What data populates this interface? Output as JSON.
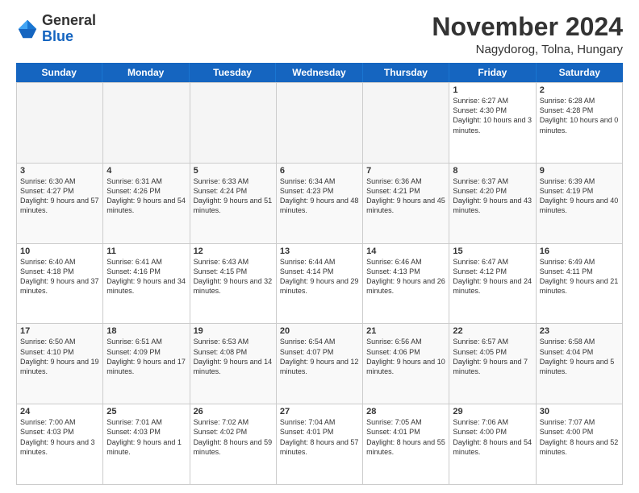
{
  "logo": {
    "line1": "General",
    "line2": "Blue"
  },
  "title": "November 2024",
  "location": "Nagydorog, Tolna, Hungary",
  "days_of_week": [
    "Sunday",
    "Monday",
    "Tuesday",
    "Wednesday",
    "Thursday",
    "Friday",
    "Saturday"
  ],
  "weeks": [
    [
      {
        "day": "",
        "info": "",
        "empty": true
      },
      {
        "day": "",
        "info": "",
        "empty": true
      },
      {
        "day": "",
        "info": "",
        "empty": true
      },
      {
        "day": "",
        "info": "",
        "empty": true
      },
      {
        "day": "",
        "info": "",
        "empty": true
      },
      {
        "day": "1",
        "info": "Sunrise: 6:27 AM\nSunset: 4:30 PM\nDaylight: 10 hours\nand 3 minutes.",
        "empty": false
      },
      {
        "day": "2",
        "info": "Sunrise: 6:28 AM\nSunset: 4:28 PM\nDaylight: 10 hours\nand 0 minutes.",
        "empty": false
      }
    ],
    [
      {
        "day": "3",
        "info": "Sunrise: 6:30 AM\nSunset: 4:27 PM\nDaylight: 9 hours\nand 57 minutes.",
        "empty": false
      },
      {
        "day": "4",
        "info": "Sunrise: 6:31 AM\nSunset: 4:26 PM\nDaylight: 9 hours\nand 54 minutes.",
        "empty": false
      },
      {
        "day": "5",
        "info": "Sunrise: 6:33 AM\nSunset: 4:24 PM\nDaylight: 9 hours\nand 51 minutes.",
        "empty": false
      },
      {
        "day": "6",
        "info": "Sunrise: 6:34 AM\nSunset: 4:23 PM\nDaylight: 9 hours\nand 48 minutes.",
        "empty": false
      },
      {
        "day": "7",
        "info": "Sunrise: 6:36 AM\nSunset: 4:21 PM\nDaylight: 9 hours\nand 45 minutes.",
        "empty": false
      },
      {
        "day": "8",
        "info": "Sunrise: 6:37 AM\nSunset: 4:20 PM\nDaylight: 9 hours\nand 43 minutes.",
        "empty": false
      },
      {
        "day": "9",
        "info": "Sunrise: 6:39 AM\nSunset: 4:19 PM\nDaylight: 9 hours\nand 40 minutes.",
        "empty": false
      }
    ],
    [
      {
        "day": "10",
        "info": "Sunrise: 6:40 AM\nSunset: 4:18 PM\nDaylight: 9 hours\nand 37 minutes.",
        "empty": false
      },
      {
        "day": "11",
        "info": "Sunrise: 6:41 AM\nSunset: 4:16 PM\nDaylight: 9 hours\nand 34 minutes.",
        "empty": false
      },
      {
        "day": "12",
        "info": "Sunrise: 6:43 AM\nSunset: 4:15 PM\nDaylight: 9 hours\nand 32 minutes.",
        "empty": false
      },
      {
        "day": "13",
        "info": "Sunrise: 6:44 AM\nSunset: 4:14 PM\nDaylight: 9 hours\nand 29 minutes.",
        "empty": false
      },
      {
        "day": "14",
        "info": "Sunrise: 6:46 AM\nSunset: 4:13 PM\nDaylight: 9 hours\nand 26 minutes.",
        "empty": false
      },
      {
        "day": "15",
        "info": "Sunrise: 6:47 AM\nSunset: 4:12 PM\nDaylight: 9 hours\nand 24 minutes.",
        "empty": false
      },
      {
        "day": "16",
        "info": "Sunrise: 6:49 AM\nSunset: 4:11 PM\nDaylight: 9 hours\nand 21 minutes.",
        "empty": false
      }
    ],
    [
      {
        "day": "17",
        "info": "Sunrise: 6:50 AM\nSunset: 4:10 PM\nDaylight: 9 hours\nand 19 minutes.",
        "empty": false
      },
      {
        "day": "18",
        "info": "Sunrise: 6:51 AM\nSunset: 4:09 PM\nDaylight: 9 hours\nand 17 minutes.",
        "empty": false
      },
      {
        "day": "19",
        "info": "Sunrise: 6:53 AM\nSunset: 4:08 PM\nDaylight: 9 hours\nand 14 minutes.",
        "empty": false
      },
      {
        "day": "20",
        "info": "Sunrise: 6:54 AM\nSunset: 4:07 PM\nDaylight: 9 hours\nand 12 minutes.",
        "empty": false
      },
      {
        "day": "21",
        "info": "Sunrise: 6:56 AM\nSunset: 4:06 PM\nDaylight: 9 hours\nand 10 minutes.",
        "empty": false
      },
      {
        "day": "22",
        "info": "Sunrise: 6:57 AM\nSunset: 4:05 PM\nDaylight: 9 hours\nand 7 minutes.",
        "empty": false
      },
      {
        "day": "23",
        "info": "Sunrise: 6:58 AM\nSunset: 4:04 PM\nDaylight: 9 hours\nand 5 minutes.",
        "empty": false
      }
    ],
    [
      {
        "day": "24",
        "info": "Sunrise: 7:00 AM\nSunset: 4:03 PM\nDaylight: 9 hours\nand 3 minutes.",
        "empty": false
      },
      {
        "day": "25",
        "info": "Sunrise: 7:01 AM\nSunset: 4:03 PM\nDaylight: 9 hours\nand 1 minute.",
        "empty": false
      },
      {
        "day": "26",
        "info": "Sunrise: 7:02 AM\nSunset: 4:02 PM\nDaylight: 8 hours\nand 59 minutes.",
        "empty": false
      },
      {
        "day": "27",
        "info": "Sunrise: 7:04 AM\nSunset: 4:01 PM\nDaylight: 8 hours\nand 57 minutes.",
        "empty": false
      },
      {
        "day": "28",
        "info": "Sunrise: 7:05 AM\nSunset: 4:01 PM\nDaylight: 8 hours\nand 55 minutes.",
        "empty": false
      },
      {
        "day": "29",
        "info": "Sunrise: 7:06 AM\nSunset: 4:00 PM\nDaylight: 8 hours\nand 54 minutes.",
        "empty": false
      },
      {
        "day": "30",
        "info": "Sunrise: 7:07 AM\nSunset: 4:00 PM\nDaylight: 8 hours\nand 52 minutes.",
        "empty": false
      }
    ]
  ]
}
